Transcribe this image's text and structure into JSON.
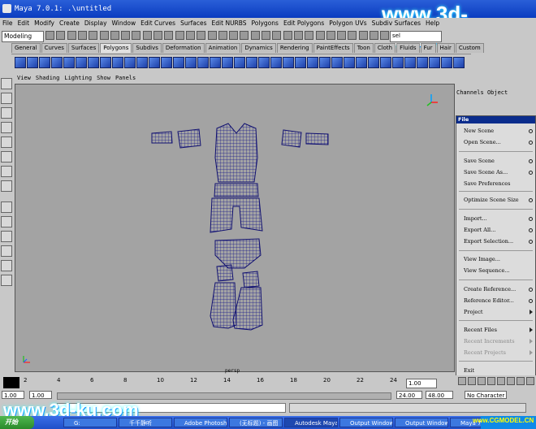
{
  "window": {
    "title": "Maya 7.0.1: .\\untitled"
  },
  "watermark": {
    "text": "www.3d-ku.com",
    "cgmodel": "www.CGMODEL.CN"
  },
  "menubar": [
    "File",
    "Edit",
    "Modify",
    "Create",
    "Display",
    "Window",
    "Edit Curves",
    "Surfaces",
    "Edit NURBS",
    "Polygons",
    "Edit Polygons",
    "Polygon UVs",
    "Subdiv Surfaces",
    "Help"
  ],
  "status": {
    "mode": "Modeling",
    "sel_field": "sel"
  },
  "shelf_tabs": [
    "General",
    "Curves",
    "Surfaces",
    "Polygons",
    "Subdivs",
    "Deformation",
    "Animation",
    "Dynamics",
    "Rendering",
    "PaintEffects",
    "Toon",
    "Cloth",
    "Fluids",
    "Fur",
    "Hair",
    "Custom"
  ],
  "shelf_active": "Polygons",
  "viewport": {
    "menu": [
      "View",
      "Shading",
      "Lighting",
      "Show",
      "Panels"
    ],
    "camera": "persp"
  },
  "channel_box": {
    "header": [
      "Channels",
      "Object"
    ]
  },
  "file_menu": {
    "title": "File",
    "items": [
      {
        "label": "New Scene",
        "option": true
      },
      {
        "label": "Open Scene...",
        "option": true
      },
      {
        "label": "Save Scene",
        "option": true
      },
      {
        "label": "Save Scene As...",
        "option": true
      },
      {
        "label": "Save Preferences",
        "option": false
      },
      {
        "label": "Optimize Scene Size",
        "option": true
      },
      {
        "label": "Import...",
        "option": true
      },
      {
        "label": "Export All...",
        "option": true
      },
      {
        "label": "Export Selection...",
        "option": true
      },
      {
        "label": "View Image...",
        "option": false
      },
      {
        "label": "View Sequence...",
        "option": false
      },
      {
        "label": "Create Reference...",
        "option": true
      },
      {
        "label": "Reference Editor...",
        "option": true
      },
      {
        "label": "Project",
        "submenu": true
      },
      {
        "label": "Recent Files",
        "submenu": true
      },
      {
        "label": "Recent Increments",
        "submenu": true,
        "disabled": true
      },
      {
        "label": "Recent Projects",
        "submenu": true,
        "disabled": true
      },
      {
        "label": "Exit"
      }
    ]
  },
  "timeline": {
    "ticks": [
      "2",
      "4",
      "6",
      "8",
      "10",
      "12",
      "14",
      "16",
      "18",
      "20",
      "22",
      "24"
    ],
    "current": "1.00"
  },
  "range": {
    "start": "1.00",
    "inner_start": "1.00",
    "end_inner": "24.00",
    "end": "48.00",
    "character": "No Character Se"
  },
  "taskbar": {
    "start": "开始",
    "tasks": [
      "G:",
      "千千静听",
      "Adobe Photosh...",
      "(无标题) - 画图",
      "Autodesk Maya ...",
      "Output Window",
      "Output Window",
      "Maya 7.0"
    ]
  }
}
